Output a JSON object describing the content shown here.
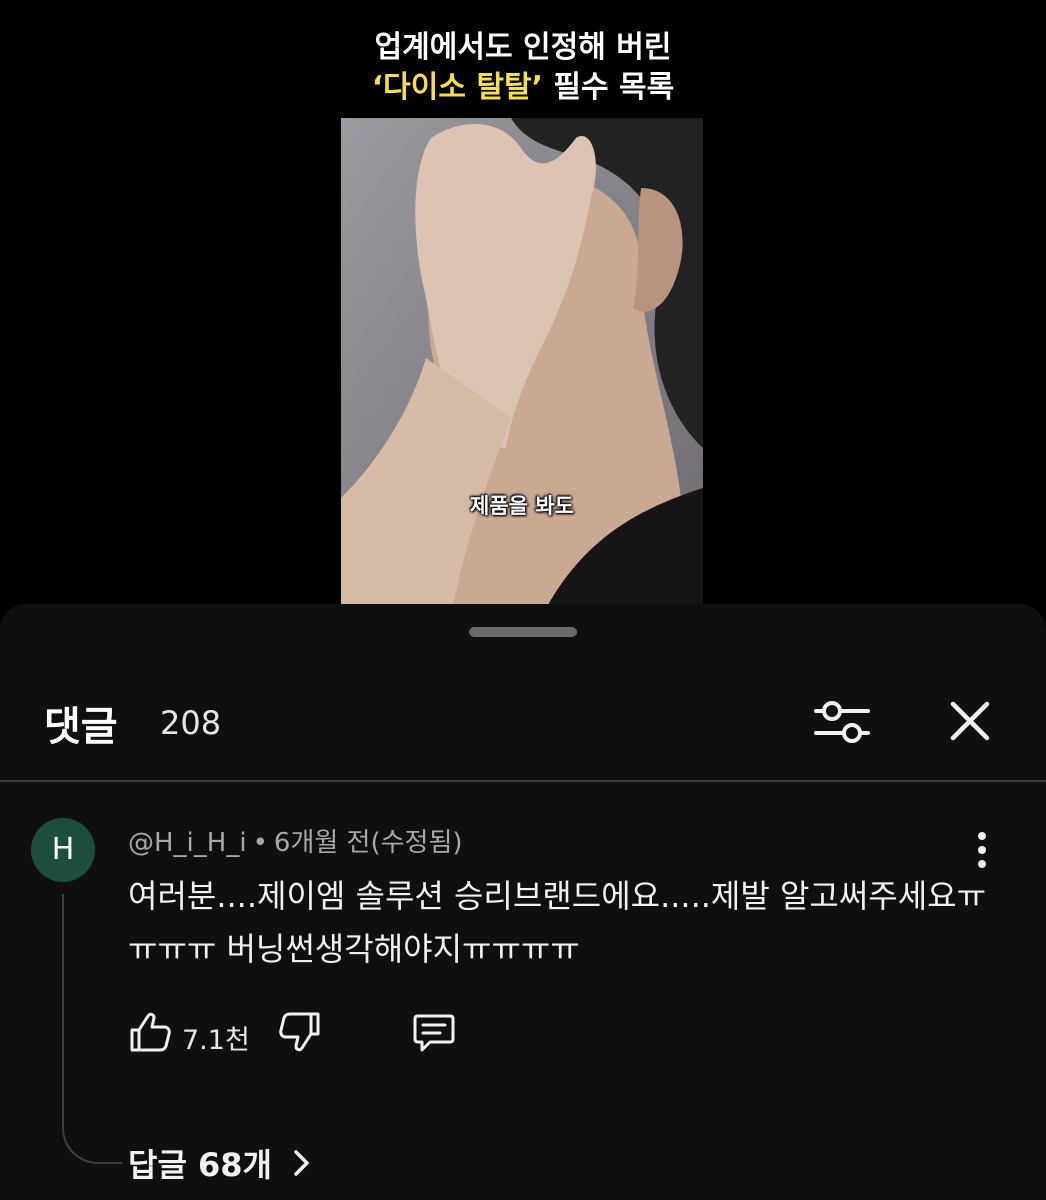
{
  "video": {
    "title_line1": "업계에서도 인정해 버린",
    "title_line2_highlight": "‘다이소 탈탈’",
    "title_line2_rest": " 필수 목록",
    "caption": "제품을 봐도",
    "highlight_color": "#f7e046"
  },
  "comments_panel": {
    "title": "댓글",
    "count": "208",
    "filter_icon": "sliders-icon",
    "close_icon": "close-icon"
  },
  "comment": {
    "avatar_letter": "H",
    "avatar_color": "#1d4d3d",
    "author": "@H_i_H_i",
    "separator": "•",
    "time": "6개월 전(수정됨)",
    "text": "여러분....제이엠 솔루션 승리브랜드에요.....제발 알고써주세요ㅠㅠㅠㅠ 버닝썬생각해야지ㅠㅠㅠㅠ",
    "like_count": "7.1천",
    "replies_label": "답글 68개"
  },
  "icons": {
    "like": "thumbs-up-icon",
    "dislike": "thumbs-down-icon",
    "reply": "comment-icon",
    "more": "more-vertical-icon",
    "chevron": "chevron-right-icon"
  }
}
